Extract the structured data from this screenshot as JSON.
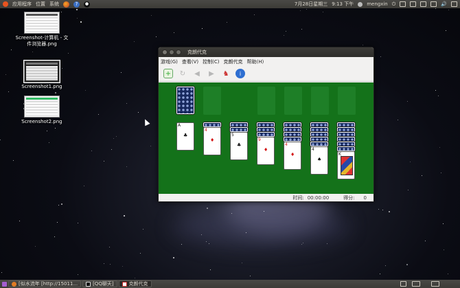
{
  "top_panel": {
    "menus": [
      "应用程序",
      "位置",
      "系统"
    ],
    "datetime": "7月28日星期三",
    "time": "9:13 下午",
    "user": "mengxin"
  },
  "desktop_icons": [
    {
      "label": "Screenshot-计算机 - 文件浏览器.png"
    },
    {
      "label": "Screenshot1.png"
    },
    {
      "label": "Screenshot2.png"
    }
  ],
  "window": {
    "title": "克朗代克",
    "menu": [
      "游戏(G)",
      "查看(V)",
      "控制(C)",
      "克朗代克",
      "帮助(H)"
    ],
    "status": {
      "time_label": "时间:",
      "time_value": "00:00:00",
      "score_label": "得分:",
      "score_value": "0"
    }
  },
  "game": {
    "tableau": [
      {
        "down": 0,
        "up": {
          "rank": "A",
          "suit": "♣",
          "color": "black"
        }
      },
      {
        "down": 1,
        "up": {
          "rank": "4",
          "suit": "♦",
          "color": "red"
        }
      },
      {
        "down": 2,
        "up": {
          "rank": "5",
          "suit": "♣",
          "color": "black"
        }
      },
      {
        "down": 3,
        "up": {
          "rank": "9",
          "suit": "♦",
          "color": "red"
        }
      },
      {
        "down": 4,
        "up": {
          "rank": "4",
          "suit": "♦",
          "color": "red"
        }
      },
      {
        "down": 5,
        "up": {
          "rank": "4",
          "suit": "♠",
          "color": "black"
        }
      },
      {
        "down": 6,
        "up": {
          "rank": "K",
          "suit": "♠",
          "color": "black"
        }
      }
    ]
  },
  "taskbar": [
    {
      "label": "[似水流年 [http://15011...",
      "active": false
    },
    {
      "label": "[QQ聊天]",
      "active": false
    },
    {
      "label": "克朗代克",
      "active": true
    }
  ],
  "colors": {
    "felt": "#14721a",
    "card_back": "#17295e",
    "panel": "#3c3b37"
  }
}
